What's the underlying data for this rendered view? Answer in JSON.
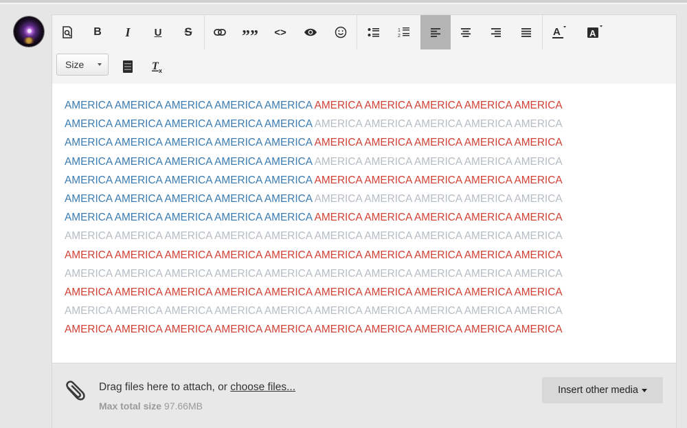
{
  "colors": {
    "blue": "#3a7bb1",
    "red": "#d23f33",
    "gray": "#b6bcc3"
  },
  "toolbar": {
    "row1": [
      {
        "name": "preview-icon",
        "glyph": "",
        "active": false
      },
      {
        "name": "bold-button",
        "glyph": "B",
        "active": false
      },
      {
        "name": "italic-button",
        "glyph": "I",
        "active": false
      },
      {
        "name": "underline-button",
        "glyph": "U",
        "active": false
      },
      {
        "name": "strikethrough-button",
        "glyph": "S",
        "active": false
      },
      {
        "name": "link-icon",
        "glyph": "",
        "active": false
      },
      {
        "name": "blockquote-button",
        "glyph": "”",
        "active": false
      },
      {
        "name": "code-button",
        "glyph": "<>",
        "active": false
      },
      {
        "name": "eye-icon",
        "glyph": "",
        "active": false
      },
      {
        "name": "emoji-icon",
        "glyph": "☺",
        "active": false
      },
      {
        "name": "bullet-list-icon",
        "glyph": "",
        "active": false
      },
      {
        "name": "numbered-list-icon",
        "glyph": "",
        "active": false
      },
      {
        "name": "align-left-icon",
        "glyph": "",
        "active": true
      },
      {
        "name": "align-center-icon",
        "glyph": "",
        "active": false
      },
      {
        "name": "align-right-icon",
        "glyph": "",
        "active": false
      },
      {
        "name": "align-justify-icon",
        "glyph": "",
        "active": false
      },
      {
        "name": "text-color-icon",
        "glyph": "A",
        "active": false
      },
      {
        "name": "background-color-icon",
        "glyph": "A",
        "active": false
      }
    ],
    "size_label": "Size"
  },
  "content": {
    "word": "AMERICA",
    "lines": [
      {
        "left": "blue",
        "right": "red"
      },
      {
        "left": "blue",
        "right": "gray"
      },
      {
        "left": "blue",
        "right": "red"
      },
      {
        "left": "blue",
        "right": "gray"
      },
      {
        "left": "blue",
        "right": "red"
      },
      {
        "left": "blue",
        "right": "gray"
      },
      {
        "left": "blue",
        "right": "red"
      },
      {
        "left": "gray",
        "right": "gray"
      },
      {
        "left": "red",
        "right": "red"
      },
      {
        "left": "gray",
        "right": "gray"
      },
      {
        "left": "red",
        "right": "red"
      },
      {
        "left": "gray",
        "right": "gray"
      },
      {
        "left": "red",
        "right": "red"
      }
    ]
  },
  "attach": {
    "drag_text": "Drag files here to attach, or ",
    "choose_link": "choose files...",
    "max_label": "Max total size",
    "max_value": "97.66MB",
    "insert_button": "Insert other media"
  }
}
